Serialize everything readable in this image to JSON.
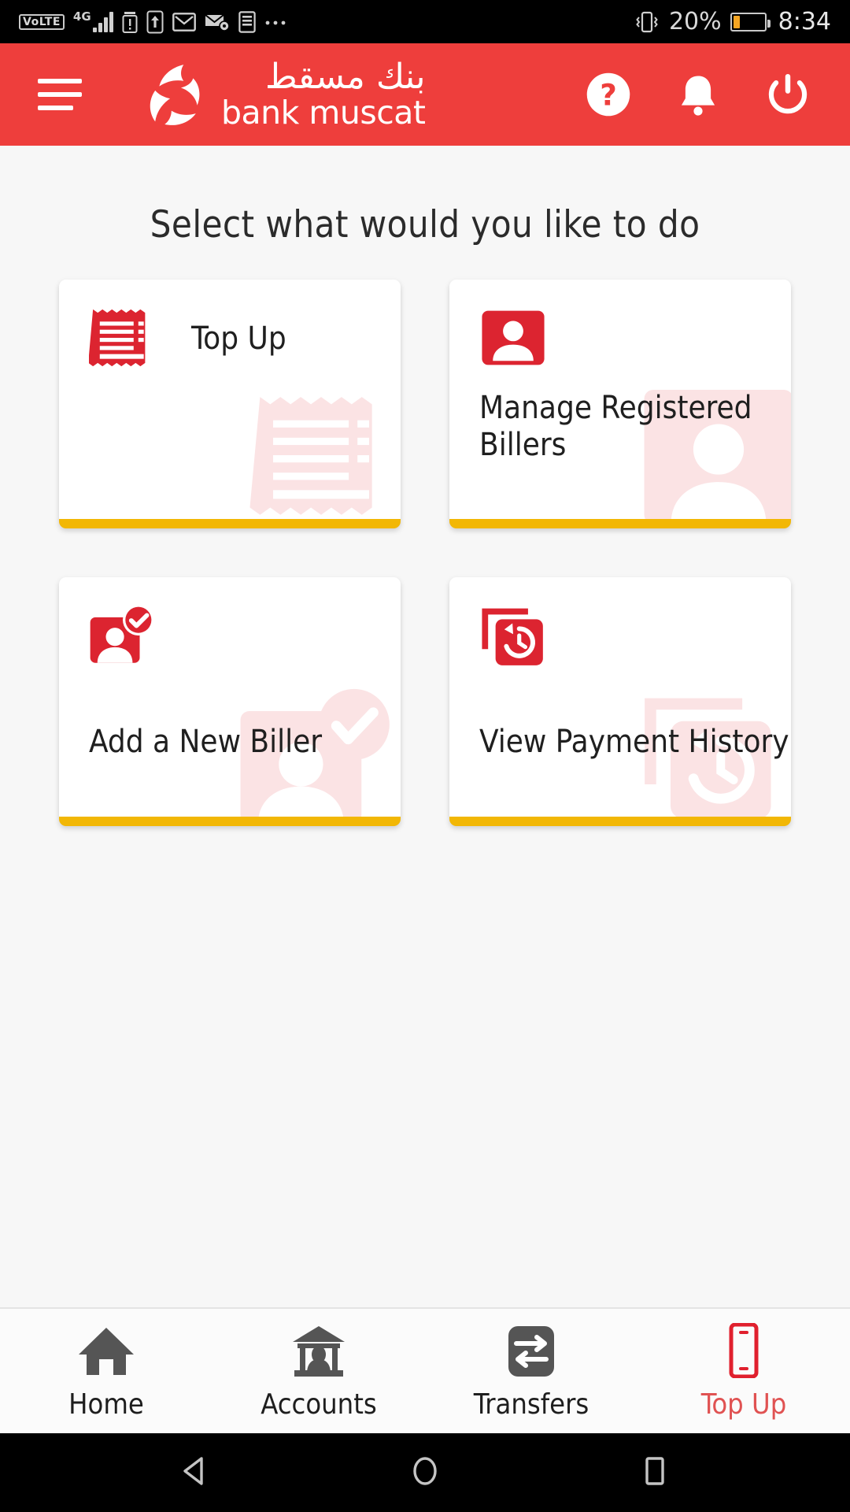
{
  "status_bar": {
    "volte_label": "VoLTE",
    "network_label": "4G",
    "icons": [
      "volte-icon",
      "4g-signal-icon",
      "sim-alert-icon",
      "upload-icon",
      "gmail-icon",
      "mail-sync-icon",
      "document-icon",
      "more-icon"
    ],
    "vibrate_icon": "vibrate-icon",
    "battery_percent": "20%",
    "battery_level": 20,
    "time": "8:34"
  },
  "header": {
    "menu_icon": "hamburger-menu-icon",
    "brand_arabic": "بنك مسقط",
    "brand_english": "bank muscat",
    "actions": [
      {
        "name": "help-icon",
        "label": "Help"
      },
      {
        "name": "notifications-bell-icon",
        "label": "Notifications"
      },
      {
        "name": "power-logout-icon",
        "label": "Logout"
      }
    ]
  },
  "main": {
    "title": "Select what would you like to do",
    "cards": [
      {
        "id": "top-up",
        "label": "Top Up",
        "icon": "receipt-icon"
      },
      {
        "id": "manage",
        "label": "Manage Registered Billers",
        "icon": "person-card-icon"
      },
      {
        "id": "add-biller",
        "label": "Add a New Biller",
        "icon": "person-check-icon"
      },
      {
        "id": "history",
        "label": "View Payment History",
        "icon": "history-clock-icon"
      }
    ]
  },
  "bottom_nav": {
    "items": [
      {
        "id": "home",
        "label": "Home",
        "icon": "home-icon",
        "active": false
      },
      {
        "id": "accounts",
        "label": "Accounts",
        "icon": "bank-icon",
        "active": false
      },
      {
        "id": "transfers",
        "label": "Transfers",
        "icon": "transfers-icon",
        "active": false
      },
      {
        "id": "topup",
        "label": "Top Up",
        "icon": "phone-icon",
        "active": true
      }
    ]
  },
  "android_nav": {
    "back": "back-triangle-icon",
    "home": "home-circle-icon",
    "recents": "recents-square-icon"
  },
  "colors": {
    "brand_red": "#EE3E3C",
    "icon_red": "#DC2430",
    "accent_yellow": "#F2B705",
    "watermark_pink": "#FBE3E4",
    "page_bg": "#F7F7F7",
    "nav_gray": "#555555",
    "active_red": "#E05252",
    "battery_orange": "#F5A623"
  }
}
